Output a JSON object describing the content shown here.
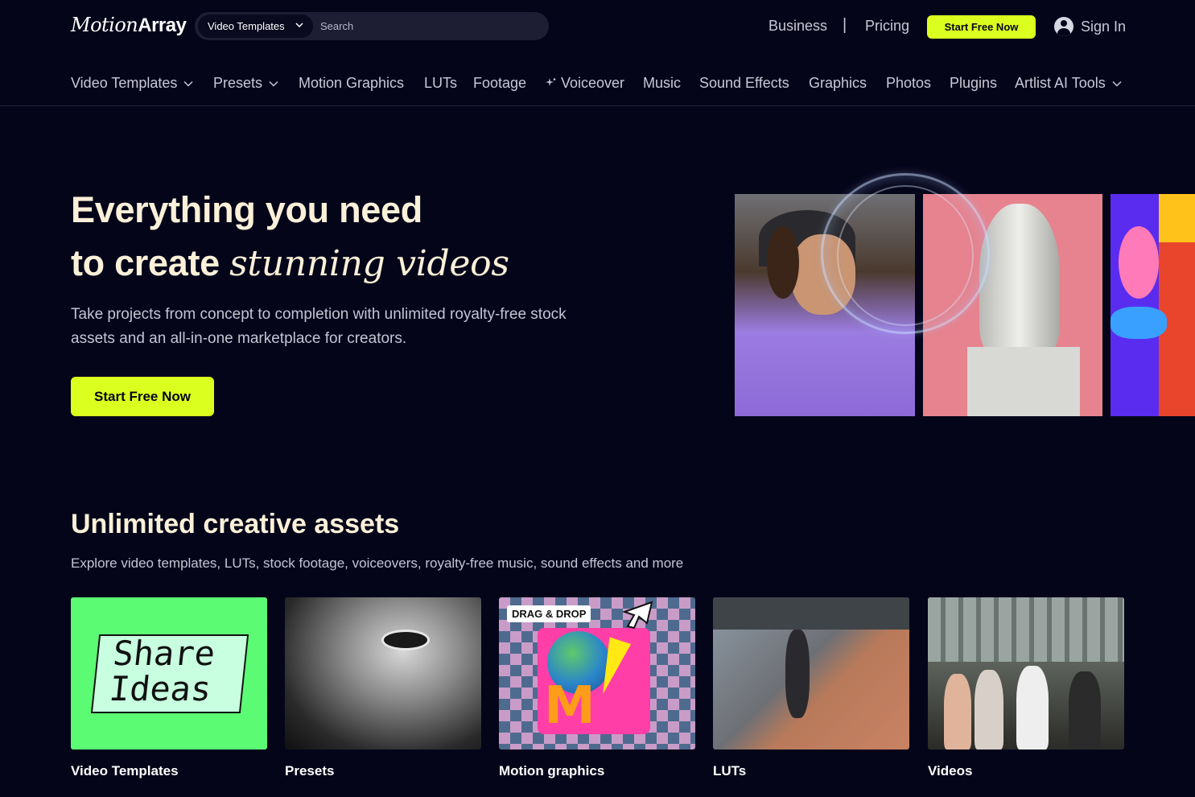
{
  "header": {
    "logo": {
      "light": "Motion",
      "bold": "Array"
    },
    "search": {
      "category": "Video Templates",
      "placeholder": "Search"
    },
    "links": {
      "business": "Business",
      "separator": "|",
      "pricing": "Pricing"
    },
    "cta": "Start Free Now",
    "sign_in": "Sign In"
  },
  "nav": {
    "items": [
      {
        "label": "Video Templates",
        "dropdown": true
      },
      {
        "label": "Presets",
        "dropdown": true
      },
      {
        "label": "Motion Graphics",
        "dropdown": false
      },
      {
        "label": "LUTs",
        "dropdown": false
      },
      {
        "label": "Footage",
        "dropdown": false
      },
      {
        "label": "Voiceover",
        "dropdown": false,
        "icon": "sparkle-icon"
      },
      {
        "label": "Music",
        "dropdown": false
      },
      {
        "label": "Sound Effects",
        "dropdown": false
      },
      {
        "label": "Graphics",
        "dropdown": false
      },
      {
        "label": "Photos",
        "dropdown": false
      },
      {
        "label": "Plugins",
        "dropdown": false
      },
      {
        "label": "Artlist AI Tools",
        "dropdown": true
      }
    ]
  },
  "hero": {
    "title_line1": "Everything you need",
    "title_line2_plain": "to create ",
    "title_line2_italic": "stunning videos",
    "subtitle": "Take projects from concept to completion with unlimited royalty-free stock assets and an all-in-one marketplace for creators.",
    "cta": "Start Free Now"
  },
  "assets": {
    "title": "Unlimited creative assets",
    "subtitle": "Explore video templates, LUTs, stock footage, voiceovers, royalty-free music, sound effects and more",
    "cards": [
      {
        "label": "Video Templates",
        "thumb_text_1": "Share",
        "thumb_text_2": "Ideas"
      },
      {
        "label": "Presets"
      },
      {
        "label": "Motion graphics",
        "badge": "DRAG & DROP"
      },
      {
        "label": "LUTs"
      },
      {
        "label": "Videos"
      }
    ]
  },
  "colors": {
    "background": "#05051a",
    "accent": "#dbff1e",
    "heading": "#fbf0d8"
  }
}
